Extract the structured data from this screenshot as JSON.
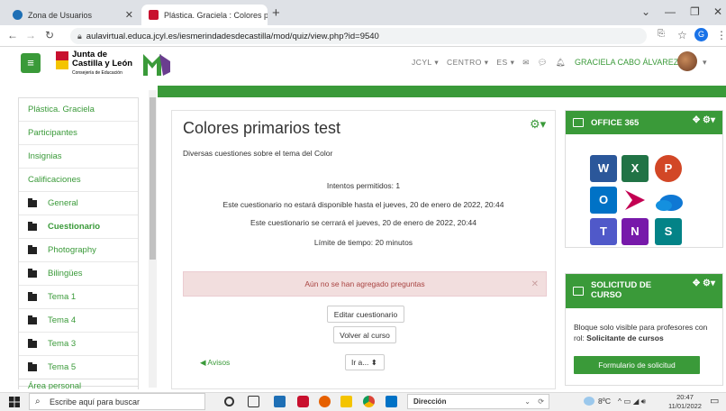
{
  "browser": {
    "tabs": [
      {
        "title": "Zona de Usuarios"
      },
      {
        "title": "Plástica. Graciela : Colores prima"
      }
    ],
    "url": "aulavirtual.educa.jcyl.es/iesmerindadesdecastilla/mod/quiz/view.php?id=9540"
  },
  "header": {
    "logo_line1": "Junta de",
    "logo_line2": "Castilla y León",
    "logo_line3": "Consejería de Educación",
    "nav": [
      "JCYL ▾",
      "CENTRO ▾",
      "ES ▾"
    ],
    "user_name": "GRACIELA CABO ÁLVAREZ"
  },
  "sidebar": {
    "items": [
      {
        "label": "Plástica. Graciela"
      },
      {
        "label": "Participantes"
      },
      {
        "label": "Insignias"
      },
      {
        "label": "Calificaciones"
      },
      {
        "label": "General"
      },
      {
        "label": "Cuestionario"
      },
      {
        "label": "Photography"
      },
      {
        "label": "Bilingües"
      },
      {
        "label": "Tema 1"
      },
      {
        "label": "Tema 4"
      },
      {
        "label": "Tema 3"
      },
      {
        "label": "Tema 5"
      }
    ],
    "area_personal": "Área personal"
  },
  "quiz": {
    "title": "Colores primarios test",
    "description": "Diversas cuestiones sobre el tema del Color",
    "attempts": "Intentos permitidos: 1",
    "opens": "Este cuestionario no estará disponible hasta el jueves, 20 de enero de 2022, 20:44",
    "closes": "Este cuestionario se cerrará el jueves, 20 de enero de 2022, 20:44",
    "time_limit": "Límite de tiempo: 20 minutos",
    "alert": "Aún no se han agregado preguntas",
    "edit_button": "Editar cuestionario",
    "back_button": "Volver al curso",
    "prev_link": "◀ Avisos",
    "jump_select": "Ir a...  ⬍"
  },
  "blocks": {
    "office_title": "OFFICE 365",
    "solicitud_title_1": "SOLICITUD DE",
    "solicitud_title_2": "CURSO",
    "solicitud_text": "Bloque solo visible para profesores con rol: ",
    "solicitud_role": "Solicitante de cursos",
    "solicitud_button": "Formulario de solicitud"
  },
  "taskbar": {
    "search_placeholder": "Escribe aquí para buscar",
    "address_label": "Dirección",
    "weather": "8ºC",
    "time": "20:47",
    "date": "11/01/2022"
  },
  "colors": {
    "accent": "#3a9a39",
    "alert_bg": "#f2dede",
    "alert_text": "#a94442"
  }
}
